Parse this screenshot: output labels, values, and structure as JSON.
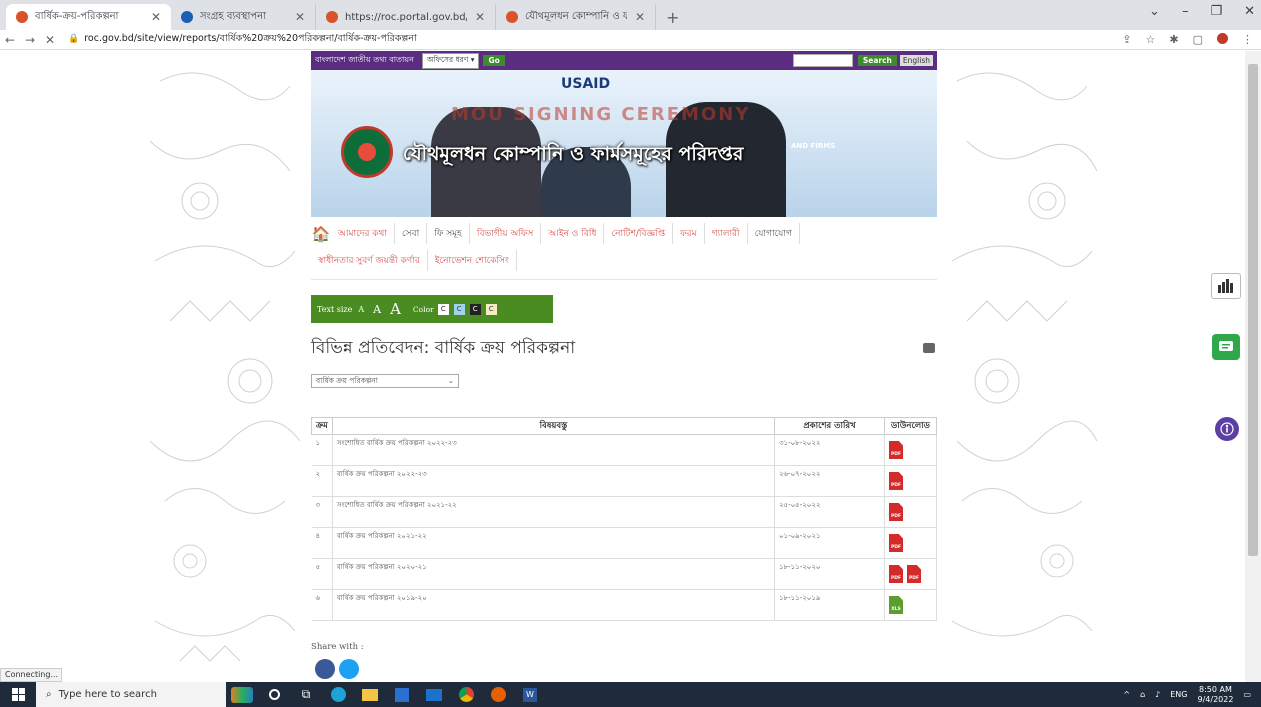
{
  "browser": {
    "tabs": [
      {
        "title": "বার্ষিক-ক্রয়-পরিকল্পনা",
        "active": true,
        "favicon_color": "#d9532a"
      },
      {
        "title": "সংগ্রহ ব্যবস্থাপনা",
        "active": false,
        "favicon_color": "#1a5fb4"
      },
      {
        "title": "https://roc.portal.gov.bd/npfadm",
        "active": false,
        "favicon_color": "#d9532a"
      },
      {
        "title": "যৌথমূলধন কোম্পানি ও ফার্মসমূহে",
        "active": false,
        "favicon_color": "#d9532a"
      }
    ],
    "new_tab_label": "+",
    "url": "roc.gov.bd/site/view/reports/বার্ষিক%20ক্রয়%20পরিকল্পনা/বার্ষিক-ক্রয়-পরিকল্পনা",
    "status_text": "Connecting..."
  },
  "site": {
    "top_strip_label": "বাংলাদেশ জাতীয় তথ্য বাতায়ন",
    "office_type_select": "অফিসের ধরণ",
    "go_label": "Go",
    "search_label": "Search",
    "lang_label": "English",
    "banner_usaid": "USAID",
    "banner_mou": "MOU SIGNING CEREMONY",
    "banner_title": "যৌথমূলধন কোম্পানি ও ফার্মসমূহের পরিদপ্তর",
    "banner_and_firms": "AND FIRMS"
  },
  "menu": {
    "items_row1": [
      {
        "label": "আমাদের কথা",
        "dark": false
      },
      {
        "label": "সেবা",
        "dark": true
      },
      {
        "label": "ফি সমূহ",
        "dark": true
      },
      {
        "label": "বিভাগীয় অফিস",
        "dark": false
      },
      {
        "label": "আইন ও বিধি",
        "dark": false
      },
      {
        "label": "নোটিশ/বিজ্ঞপ্তি",
        "dark": false
      },
      {
        "label": "ফরম",
        "dark": false
      },
      {
        "label": "গ্যালারী",
        "dark": false
      },
      {
        "label": "যোগাযোগ",
        "dark": true
      }
    ],
    "items_row2": [
      {
        "label": "স্বাধীনতার সুবর্ণ জয়ন্তী কর্ণার"
      },
      {
        "label": "ইনোভেশন শোকেসিং"
      }
    ]
  },
  "accessibility": {
    "text_size_label": "Text size",
    "a_small": "A",
    "a_medium": "A",
    "a_large": "A",
    "color_label": "Color",
    "color_boxes": [
      {
        "label": "C",
        "bg": "#ffffff",
        "fg": "#333333"
      },
      {
        "label": "C",
        "bg": "#9fd3f0",
        "fg": "#333333"
      },
      {
        "label": "C",
        "bg": "#222222",
        "fg": "#ffffff"
      },
      {
        "label": "C",
        "bg": "#f5eec5",
        "fg": "#333333"
      }
    ]
  },
  "page": {
    "heading": "বিভিন্ন প্রতিবেদন: বার্ষিক ক্রয় পরিকল্পনা",
    "filter_value": "বার্ষিক ক্রয় পরিকল্পনা",
    "share_label": "Share with :"
  },
  "table": {
    "headers": [
      "ক্রম",
      "বিষয়বস্তু",
      "প্রকাশের তারিখ",
      "ডাউনলোড"
    ],
    "rows": [
      {
        "num": "১",
        "subject": "সংশোধিত বার্ষিক ক্রয় পরিকল্পনা ২০২২-২৩",
        "date": "৩১-০৮-২০২২",
        "files": [
          "PDF"
        ]
      },
      {
        "num": "২",
        "subject": "বার্ষিক ক্রয় পরিকল্পনা ২০২২-২৩",
        "date": "২৬-০৭-২০২২",
        "files": [
          "PDF"
        ]
      },
      {
        "num": "৩",
        "subject": "সংশোধিত বার্ষিক ক্রয় পরিকল্পনা ২০২১-২২",
        "date": "২৫-০৫-২০২২",
        "files": [
          "PDF"
        ]
      },
      {
        "num": "৪",
        "subject": "বার্ষিক ক্রয় পরিকল্পনা ২০২১-২২",
        "date": "০১-০৯-২০২১",
        "files": [
          "PDF"
        ]
      },
      {
        "num": "৫",
        "subject": "বার্ষিক ক্রয় পরিকল্পনা ২০২০-২১",
        "date": "১৮-১১-২০২০",
        "files": [
          "PDF",
          "PDF"
        ]
      },
      {
        "num": "৬",
        "subject": "বার্ষিক ক্রয় পরিকল্পনা ২০১৯-২০",
        "date": "১৮-১১-২০১৯",
        "files": [
          "XLS"
        ]
      }
    ]
  },
  "taskbar": {
    "search_placeholder": "Type here to search",
    "lang": "ENG",
    "time": "8:50 AM",
    "date": "9/4/2022"
  },
  "colors": {
    "site_purple": "#5a2d82",
    "site_green": "#4a8c22",
    "pdf_red": "#d32a2a",
    "xls_green": "#5c9e2e",
    "float_green": "#2ea84b",
    "float_purple": "#5b3fa3"
  }
}
